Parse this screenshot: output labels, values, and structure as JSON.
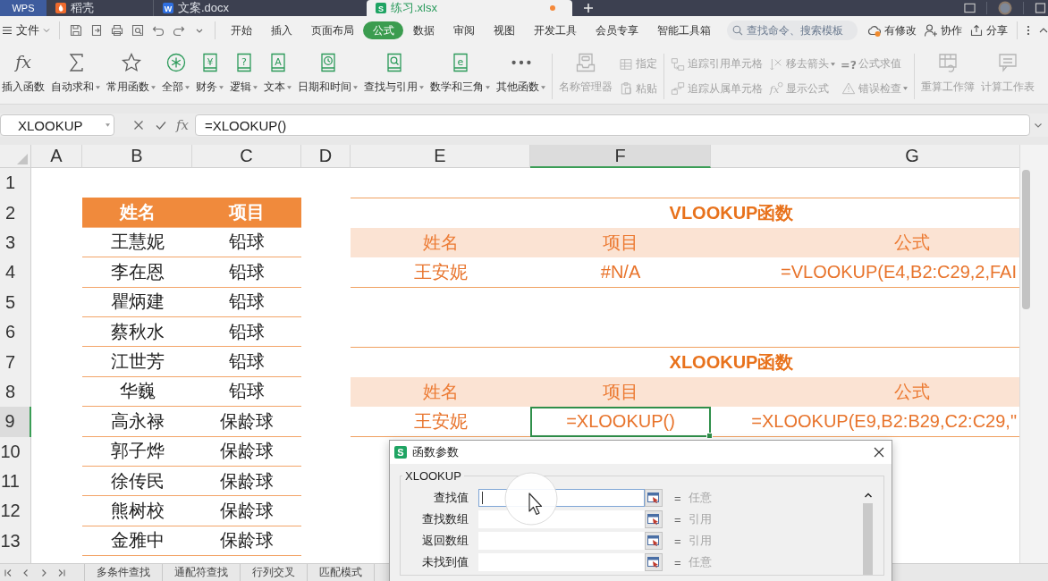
{
  "title_bar": {
    "tabs": [
      {
        "label": "WPS",
        "kind": "home",
        "selected": false,
        "unsaved": false
      },
      {
        "label": "稻壳",
        "kind": "docer",
        "selected": false,
        "unsaved": false
      },
      {
        "label": "文案.docx",
        "kind": "writer",
        "glyph": "W",
        "selected": false,
        "unsaved": false
      },
      {
        "label": "练习.xlsx",
        "kind": "sheet",
        "glyph": "S",
        "selected": true,
        "unsaved": true
      }
    ]
  },
  "menu_bar": {
    "file_menu": "文件",
    "tabs": [
      {
        "label": "开始",
        "selected": false
      },
      {
        "label": "插入",
        "selected": false
      },
      {
        "label": "页面布局",
        "selected": false
      },
      {
        "label": "公式",
        "selected": true
      },
      {
        "label": "数据",
        "selected": false
      },
      {
        "label": "审阅",
        "selected": false
      },
      {
        "label": "视图",
        "selected": false
      },
      {
        "label": "开发工具",
        "selected": false
      },
      {
        "label": "会员专享",
        "selected": false
      },
      {
        "label": "智能工具箱",
        "selected": false
      }
    ],
    "search": {
      "placeholder": "查找命令、搜索模板"
    },
    "actions": [
      {
        "label": "有修改",
        "kind": "cloud"
      },
      {
        "label": "协作",
        "kind": "collaborate"
      },
      {
        "label": "分享",
        "kind": "share"
      }
    ]
  },
  "ribbon": {
    "groups": [
      {
        "disabled": false,
        "large": [
          {
            "label": "插入函数",
            "kind": "function",
            "glyph": "fx",
            "dropdown": false
          },
          {
            "label": "自动求和",
            "kind": "sum",
            "dropdown": true
          },
          {
            "label": "常用函数",
            "kind": "star",
            "dropdown": true
          },
          {
            "label": "全部",
            "kind": "all",
            "dropdown": true
          },
          {
            "label": "财务",
            "kind": "book",
            "glyph": "¥",
            "dropdown": true
          },
          {
            "label": "逻辑",
            "kind": "book",
            "glyph": "?",
            "dropdown": true
          },
          {
            "label": "文本",
            "kind": "book",
            "glyph": "A",
            "dropdown": true
          },
          {
            "label": "日期和时间",
            "kind": "clock-book",
            "dropdown": true
          },
          {
            "label": "查找与引用",
            "kind": "search-book",
            "dropdown": true
          },
          {
            "label": "数学和三角",
            "kind": "book",
            "glyph": "e",
            "dropdown": true
          },
          {
            "label": "其他函数",
            "kind": "more",
            "dropdown": true
          }
        ]
      },
      {
        "disabled": true,
        "large": [
          {
            "label": "名称管理器",
            "kind": "name-manager",
            "dropdown": false
          }
        ],
        "small": [
          {
            "label": "指定",
            "kind": "define",
            "dropdown": false
          },
          {
            "label": "粘贴",
            "kind": "paste",
            "dropdown": false
          }
        ]
      },
      {
        "disabled": true,
        "small": [
          {
            "label": "追踪引用单元格",
            "kind": "trace-precedents",
            "dropdown": false
          },
          {
            "label": "移去箭头",
            "kind": "remove-arrows",
            "dropdown": true
          },
          {
            "label": "公式求值",
            "kind": "evaluate",
            "glyph": "=?",
            "dropdown": false
          },
          {
            "label": "追踪从属单元格",
            "kind": "trace-dependents",
            "dropdown": false
          },
          {
            "label": "显示公式",
            "kind": "show-formulas",
            "glyph": "fx",
            "dropdown": false
          },
          {
            "label": "错误检查",
            "kind": "error-check",
            "dropdown": true
          }
        ]
      },
      {
        "disabled": true,
        "large": [
          {
            "label": "重算工作簿",
            "kind": "recalc-workbook",
            "dropdown": false
          },
          {
            "label": "计算工作表",
            "kind": "calc-sheet",
            "dropdown": false
          }
        ]
      }
    ]
  },
  "formula_bar": {
    "name_box": "XLOOKUP",
    "function_button": "fx",
    "formula": "=XLOOKUP()"
  },
  "sheet": {
    "columns": [
      {
        "label": "A",
        "selected": false
      },
      {
        "label": "B",
        "selected": false
      },
      {
        "label": "C",
        "selected": false
      },
      {
        "label": "D",
        "selected": false
      },
      {
        "label": "E",
        "selected": false
      },
      {
        "label": "F",
        "selected": true
      },
      {
        "label": "G",
        "selected": false
      }
    ],
    "rows": [
      {
        "label": "1",
        "selected": false
      },
      {
        "label": "2",
        "selected": false
      },
      {
        "label": "3",
        "selected": false
      },
      {
        "label": "4",
        "selected": false
      },
      {
        "label": "5",
        "selected": false
      },
      {
        "label": "6",
        "selected": false
      },
      {
        "label": "7",
        "selected": false
      },
      {
        "label": "8",
        "selected": false
      },
      {
        "label": "9",
        "selected": true
      },
      {
        "label": "10",
        "selected": false
      },
      {
        "label": "11",
        "selected": false
      },
      {
        "label": "12",
        "selected": false
      },
      {
        "label": "13",
        "selected": false
      }
    ],
    "roster": {
      "headers": [
        "姓名",
        "项目"
      ],
      "rows": [
        [
          "王慧妮",
          "铅球"
        ],
        [
          "李在恩",
          "铅球"
        ],
        [
          "瞿炳建",
          "铅球"
        ],
        [
          "蔡秋水",
          "铅球"
        ],
        [
          "江世芳",
          "铅球"
        ],
        [
          "华巍",
          "铅球"
        ],
        [
          "高永禄",
          "保龄球"
        ],
        [
          "郭子烨",
          "保龄球"
        ],
        [
          "徐传民",
          "保龄球"
        ],
        [
          "熊树校",
          "保龄球"
        ],
        [
          "金雅中",
          "保龄球"
        ]
      ]
    },
    "lookups": [
      {
        "title": "VLOOKUP函数",
        "headers": [
          "姓名",
          "项目",
          "公式"
        ],
        "values": [
          {
            "text": "王安妮",
            "selected": false
          },
          {
            "text": "#N/A",
            "selected": false
          },
          {
            "text": "=VLOOKUP(E4,B2:C29,2,FAI",
            "selected": false
          }
        ]
      },
      {
        "title": "XLOOKUP函数",
        "headers": [
          "姓名",
          "项目",
          "公式"
        ],
        "values": [
          {
            "text": "王安妮",
            "selected": false
          },
          {
            "text": "=XLOOKUP()",
            "selected": true
          },
          {
            "text": "=XLOOKUP(E9,B2:B29,C2:C29,\"",
            "selected": false
          }
        ]
      }
    ]
  },
  "sheet_tabs": [
    {
      "label": "多条件查找",
      "selected": false
    },
    {
      "label": "通配符查找",
      "selected": false
    },
    {
      "label": "行列交叉",
      "selected": false
    },
    {
      "label": "匹配模式",
      "selected": false
    }
  ],
  "dialog": {
    "title": "函数参数",
    "glyph": "S",
    "function": "XLOOKUP",
    "arguments": [
      {
        "label": "查找值",
        "equals": "=",
        "type": "任意",
        "focused": true
      },
      {
        "label": "查找数组",
        "equals": "=",
        "type": "引用",
        "focused": false
      },
      {
        "label": "返回数组",
        "equals": "=",
        "type": "引用",
        "focused": false
      },
      {
        "label": "未找到值",
        "equals": "=",
        "type": "任意",
        "focused": false
      }
    ]
  }
}
